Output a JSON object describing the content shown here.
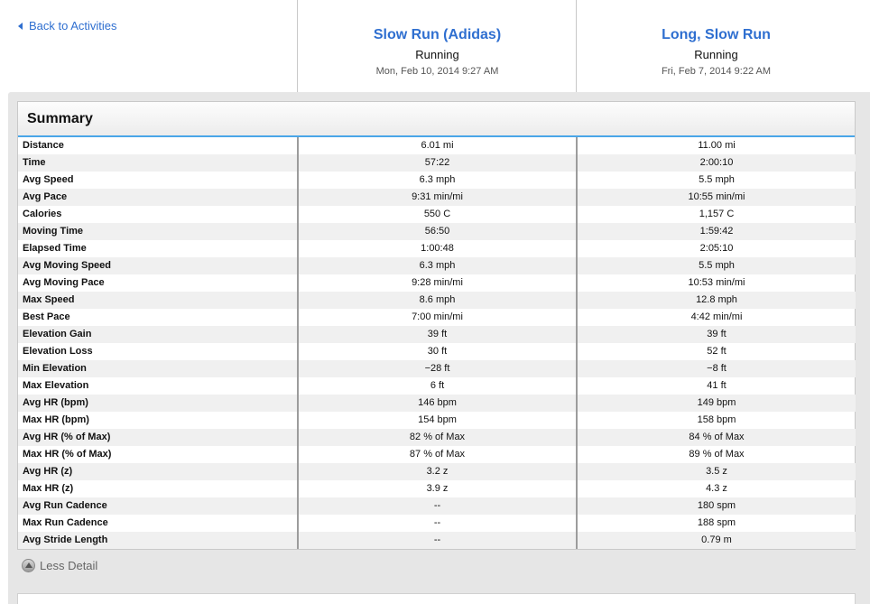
{
  "back_link": "Back to Activities",
  "activities": [
    {
      "title": "Slow Run (Adidas)",
      "type": "Running",
      "date": "Mon, Feb 10, 2014 9:27 AM"
    },
    {
      "title": "Long, Slow Run",
      "type": "Running",
      "date": "Fri, Feb 7, 2014 9:22 AM"
    }
  ],
  "summary": {
    "title": "Summary",
    "rows": [
      {
        "label": "Distance",
        "a": "6.01 mi",
        "b": "11.00 mi"
      },
      {
        "label": "Time",
        "a": "57:22",
        "b": "2:00:10"
      },
      {
        "label": "Avg Speed",
        "a": "6.3 mph",
        "b": "5.5 mph"
      },
      {
        "label": "Avg Pace",
        "a": "9:31 min/mi",
        "b": "10:55 min/mi"
      },
      {
        "label": "Calories",
        "a": "550 C",
        "b": "1,157 C"
      },
      {
        "label": "Moving Time",
        "a": "56:50",
        "b": "1:59:42"
      },
      {
        "label": "Elapsed Time",
        "a": "1:00:48",
        "b": "2:05:10"
      },
      {
        "label": "Avg Moving Speed",
        "a": "6.3 mph",
        "b": "5.5 mph"
      },
      {
        "label": "Avg Moving Pace",
        "a": "9:28 min/mi",
        "b": "10:53 min/mi"
      },
      {
        "label": "Max Speed",
        "a": "8.6 mph",
        "b": "12.8 mph"
      },
      {
        "label": "Best Pace",
        "a": "7:00 min/mi",
        "b": "4:42 min/mi"
      },
      {
        "label": "Elevation Gain",
        "a": "39 ft",
        "b": "39 ft"
      },
      {
        "label": "Elevation Loss",
        "a": "30 ft",
        "b": "52 ft"
      },
      {
        "label": "Min Elevation",
        "a": "−28 ft",
        "b": "−8 ft"
      },
      {
        "label": "Max Elevation",
        "a": "6 ft",
        "b": "41 ft"
      },
      {
        "label": "Avg HR (bpm)",
        "a": "146 bpm",
        "b": "149 bpm"
      },
      {
        "label": "Max HR (bpm)",
        "a": "154 bpm",
        "b": "158 bpm"
      },
      {
        "label": "Avg HR (% of Max)",
        "a": "82 % of Max",
        "b": "84 % of Max"
      },
      {
        "label": "Max HR (% of Max)",
        "a": "87 % of Max",
        "b": "89 % of Max"
      },
      {
        "label": "Avg HR (z)",
        "a": "3.2 z",
        "b": "3.5 z"
      },
      {
        "label": "Max HR (z)",
        "a": "3.9 z",
        "b": "4.3 z"
      },
      {
        "label": "Avg Run Cadence",
        "a": "--",
        "b": "180 spm"
      },
      {
        "label": "Max Run Cadence",
        "a": "--",
        "b": "188 spm"
      },
      {
        "label": "Avg Stride Length",
        "a": "--",
        "b": "0.79 m"
      }
    ]
  },
  "less_detail": "Less Detail",
  "icons": {
    "back": "back-triangle-icon",
    "less_detail": "collapse-up-icon"
  },
  "colors": {
    "link": "#2f6fd0",
    "accent_border": "#4aa6e8"
  }
}
